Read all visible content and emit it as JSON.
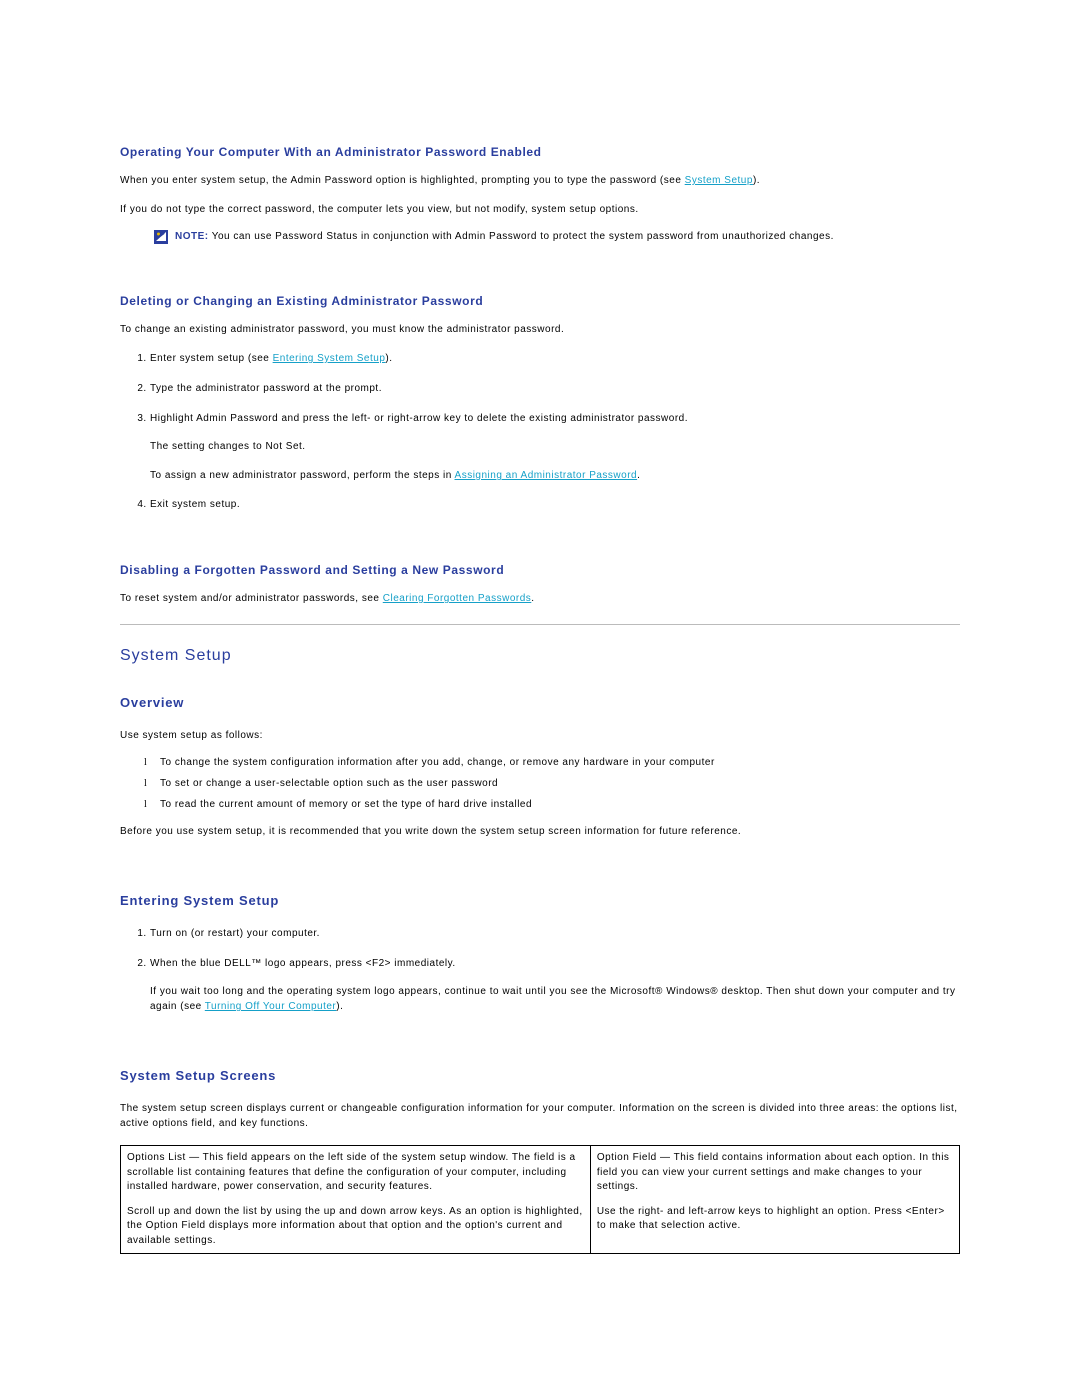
{
  "headings": {
    "h3_admin_enabled": "Operating Your Computer With an Administrator Password Enabled",
    "h3_delete_change": "Deleting or Changing an Existing Administrator Password",
    "h3_disable_forgotten": "Disabling a Forgotten Password and Setting a New Password",
    "h2_system_setup": "System Setup",
    "h4_overview": "Overview",
    "h4_entering": "Entering System Setup",
    "h4_screens": "System Setup Screens"
  },
  "para": {
    "admin_enabled_1_pre": "When you enter system setup, the Admin Password option is highlighted, prompting you to type the password (see ",
    "admin_enabled_1_link": "System Setup",
    "admin_enabled_1_post": ").",
    "admin_enabled_2": "If you do not type the correct password, the computer lets you view, but not modify, system setup options.",
    "note_label": "NOTE:",
    "note_text": " You can use Password Status in conjunction with Admin Password to protect the system password from unauthorized changes.",
    "delete_change_intro": "To change an existing administrator password, you must know the administrator password.",
    "disable_intro_pre": "To reset system and/or administrator passwords, see ",
    "disable_intro_link": "Clearing Forgotten Passwords",
    "disable_intro_post": ".",
    "overview_intro": "Use system setup as follows:",
    "overview_after": "Before you use system setup, it is recommended that you write down the system setup screen information for future reference.",
    "screens_intro": "The system setup screen displays current or changeable configuration information for your computer. Information on the screen is divided into three areas: the options list, active options field, and key functions."
  },
  "ol_delete_change": {
    "i1_pre": "Enter system setup (see ",
    "i1_link": "Entering System Setup",
    "i1_post": ").",
    "i2": "Type the administrator password at the prompt.",
    "i3": "Highlight Admin Password and press the left- or right-arrow key to delete the existing administrator password.",
    "i3_b": "The setting changes to Not Set.",
    "i3_c_pre": "To assign a new administrator password, perform the steps in ",
    "i3_c_link": "Assigning an Administrator Password",
    "i3_c_post": ".",
    "i4": "Exit system setup."
  },
  "overview_list": {
    "i1": "To change the system configuration information after you add, change, or remove any hardware in your computer",
    "i2": "To set or change a user-selectable option such as the user password",
    "i3": "To read the current amount of memory or set the type of hard drive installed"
  },
  "ol_entering": {
    "i1": "Turn on (or restart) your computer.",
    "i2": "When the blue DELL™ logo appears, press <F2> immediately.",
    "i2_b_pre": "If you wait too long and the operating system logo appears, continue to wait until you see the Microsoft® Windows® desktop. Then shut down your computer and try again (see ",
    "i2_b_link": "Turning Off Your Computer",
    "i2_b_post": ")."
  },
  "table": {
    "left_top": "Options List — This field appears on the left side of the system setup window. The field is a scrollable list containing features that define the configuration of your computer, including installed hardware, power conservation, and security features.",
    "left_bottom": "Scroll up and down the list by using the up and down arrow keys. As an option is highlighted, the Option Field displays more information about that option and the option's current and available settings.",
    "right_top": "Option Field — This field contains information about each option. In this field you can view your current settings and make changes to your settings.",
    "right_bottom": "Use the right- and left-arrow keys to highlight an option. Press <Enter> to make that selection active."
  }
}
